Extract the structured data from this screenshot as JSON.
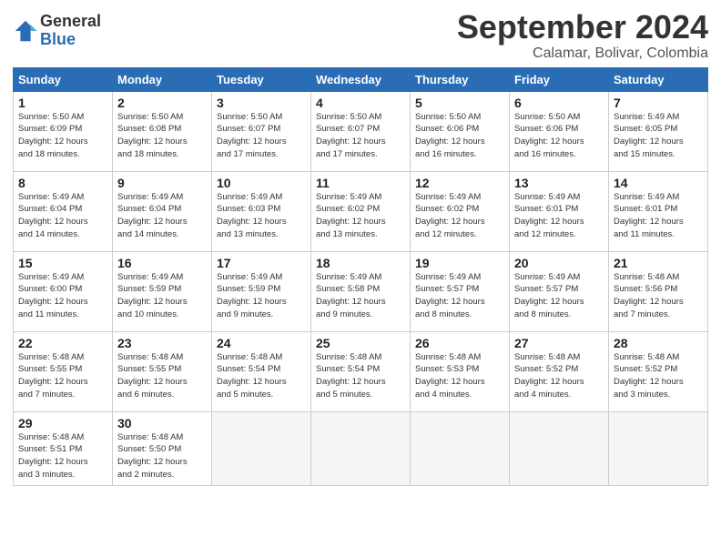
{
  "logo": {
    "general": "General",
    "blue": "Blue"
  },
  "title": "September 2024",
  "location": "Calamar, Bolivar, Colombia",
  "headers": [
    "Sunday",
    "Monday",
    "Tuesday",
    "Wednesday",
    "Thursday",
    "Friday",
    "Saturday"
  ],
  "weeks": [
    [
      {
        "day": "1",
        "info": "Sunrise: 5:50 AM\nSunset: 6:09 PM\nDaylight: 12 hours\nand 18 minutes."
      },
      {
        "day": "2",
        "info": "Sunrise: 5:50 AM\nSunset: 6:08 PM\nDaylight: 12 hours\nand 18 minutes."
      },
      {
        "day": "3",
        "info": "Sunrise: 5:50 AM\nSunset: 6:07 PM\nDaylight: 12 hours\nand 17 minutes."
      },
      {
        "day": "4",
        "info": "Sunrise: 5:50 AM\nSunset: 6:07 PM\nDaylight: 12 hours\nand 17 minutes."
      },
      {
        "day": "5",
        "info": "Sunrise: 5:50 AM\nSunset: 6:06 PM\nDaylight: 12 hours\nand 16 minutes."
      },
      {
        "day": "6",
        "info": "Sunrise: 5:50 AM\nSunset: 6:06 PM\nDaylight: 12 hours\nand 16 minutes."
      },
      {
        "day": "7",
        "info": "Sunrise: 5:49 AM\nSunset: 6:05 PM\nDaylight: 12 hours\nand 15 minutes."
      }
    ],
    [
      {
        "day": "8",
        "info": "Sunrise: 5:49 AM\nSunset: 6:04 PM\nDaylight: 12 hours\nand 14 minutes."
      },
      {
        "day": "9",
        "info": "Sunrise: 5:49 AM\nSunset: 6:04 PM\nDaylight: 12 hours\nand 14 minutes."
      },
      {
        "day": "10",
        "info": "Sunrise: 5:49 AM\nSunset: 6:03 PM\nDaylight: 12 hours\nand 13 minutes."
      },
      {
        "day": "11",
        "info": "Sunrise: 5:49 AM\nSunset: 6:02 PM\nDaylight: 12 hours\nand 13 minutes."
      },
      {
        "day": "12",
        "info": "Sunrise: 5:49 AM\nSunset: 6:02 PM\nDaylight: 12 hours\nand 12 minutes."
      },
      {
        "day": "13",
        "info": "Sunrise: 5:49 AM\nSunset: 6:01 PM\nDaylight: 12 hours\nand 12 minutes."
      },
      {
        "day": "14",
        "info": "Sunrise: 5:49 AM\nSunset: 6:01 PM\nDaylight: 12 hours\nand 11 minutes."
      }
    ],
    [
      {
        "day": "15",
        "info": "Sunrise: 5:49 AM\nSunset: 6:00 PM\nDaylight: 12 hours\nand 11 minutes."
      },
      {
        "day": "16",
        "info": "Sunrise: 5:49 AM\nSunset: 5:59 PM\nDaylight: 12 hours\nand 10 minutes."
      },
      {
        "day": "17",
        "info": "Sunrise: 5:49 AM\nSunset: 5:59 PM\nDaylight: 12 hours\nand 9 minutes."
      },
      {
        "day": "18",
        "info": "Sunrise: 5:49 AM\nSunset: 5:58 PM\nDaylight: 12 hours\nand 9 minutes."
      },
      {
        "day": "19",
        "info": "Sunrise: 5:49 AM\nSunset: 5:57 PM\nDaylight: 12 hours\nand 8 minutes."
      },
      {
        "day": "20",
        "info": "Sunrise: 5:49 AM\nSunset: 5:57 PM\nDaylight: 12 hours\nand 8 minutes."
      },
      {
        "day": "21",
        "info": "Sunrise: 5:48 AM\nSunset: 5:56 PM\nDaylight: 12 hours\nand 7 minutes."
      }
    ],
    [
      {
        "day": "22",
        "info": "Sunrise: 5:48 AM\nSunset: 5:55 PM\nDaylight: 12 hours\nand 7 minutes."
      },
      {
        "day": "23",
        "info": "Sunrise: 5:48 AM\nSunset: 5:55 PM\nDaylight: 12 hours\nand 6 minutes."
      },
      {
        "day": "24",
        "info": "Sunrise: 5:48 AM\nSunset: 5:54 PM\nDaylight: 12 hours\nand 5 minutes."
      },
      {
        "day": "25",
        "info": "Sunrise: 5:48 AM\nSunset: 5:54 PM\nDaylight: 12 hours\nand 5 minutes."
      },
      {
        "day": "26",
        "info": "Sunrise: 5:48 AM\nSunset: 5:53 PM\nDaylight: 12 hours\nand 4 minutes."
      },
      {
        "day": "27",
        "info": "Sunrise: 5:48 AM\nSunset: 5:52 PM\nDaylight: 12 hours\nand 4 minutes."
      },
      {
        "day": "28",
        "info": "Sunrise: 5:48 AM\nSunset: 5:52 PM\nDaylight: 12 hours\nand 3 minutes."
      }
    ],
    [
      {
        "day": "29",
        "info": "Sunrise: 5:48 AM\nSunset: 5:51 PM\nDaylight: 12 hours\nand 3 minutes."
      },
      {
        "day": "30",
        "info": "Sunrise: 5:48 AM\nSunset: 5:50 PM\nDaylight: 12 hours\nand 2 minutes."
      },
      {
        "day": "",
        "info": ""
      },
      {
        "day": "",
        "info": ""
      },
      {
        "day": "",
        "info": ""
      },
      {
        "day": "",
        "info": ""
      },
      {
        "day": "",
        "info": ""
      }
    ]
  ]
}
